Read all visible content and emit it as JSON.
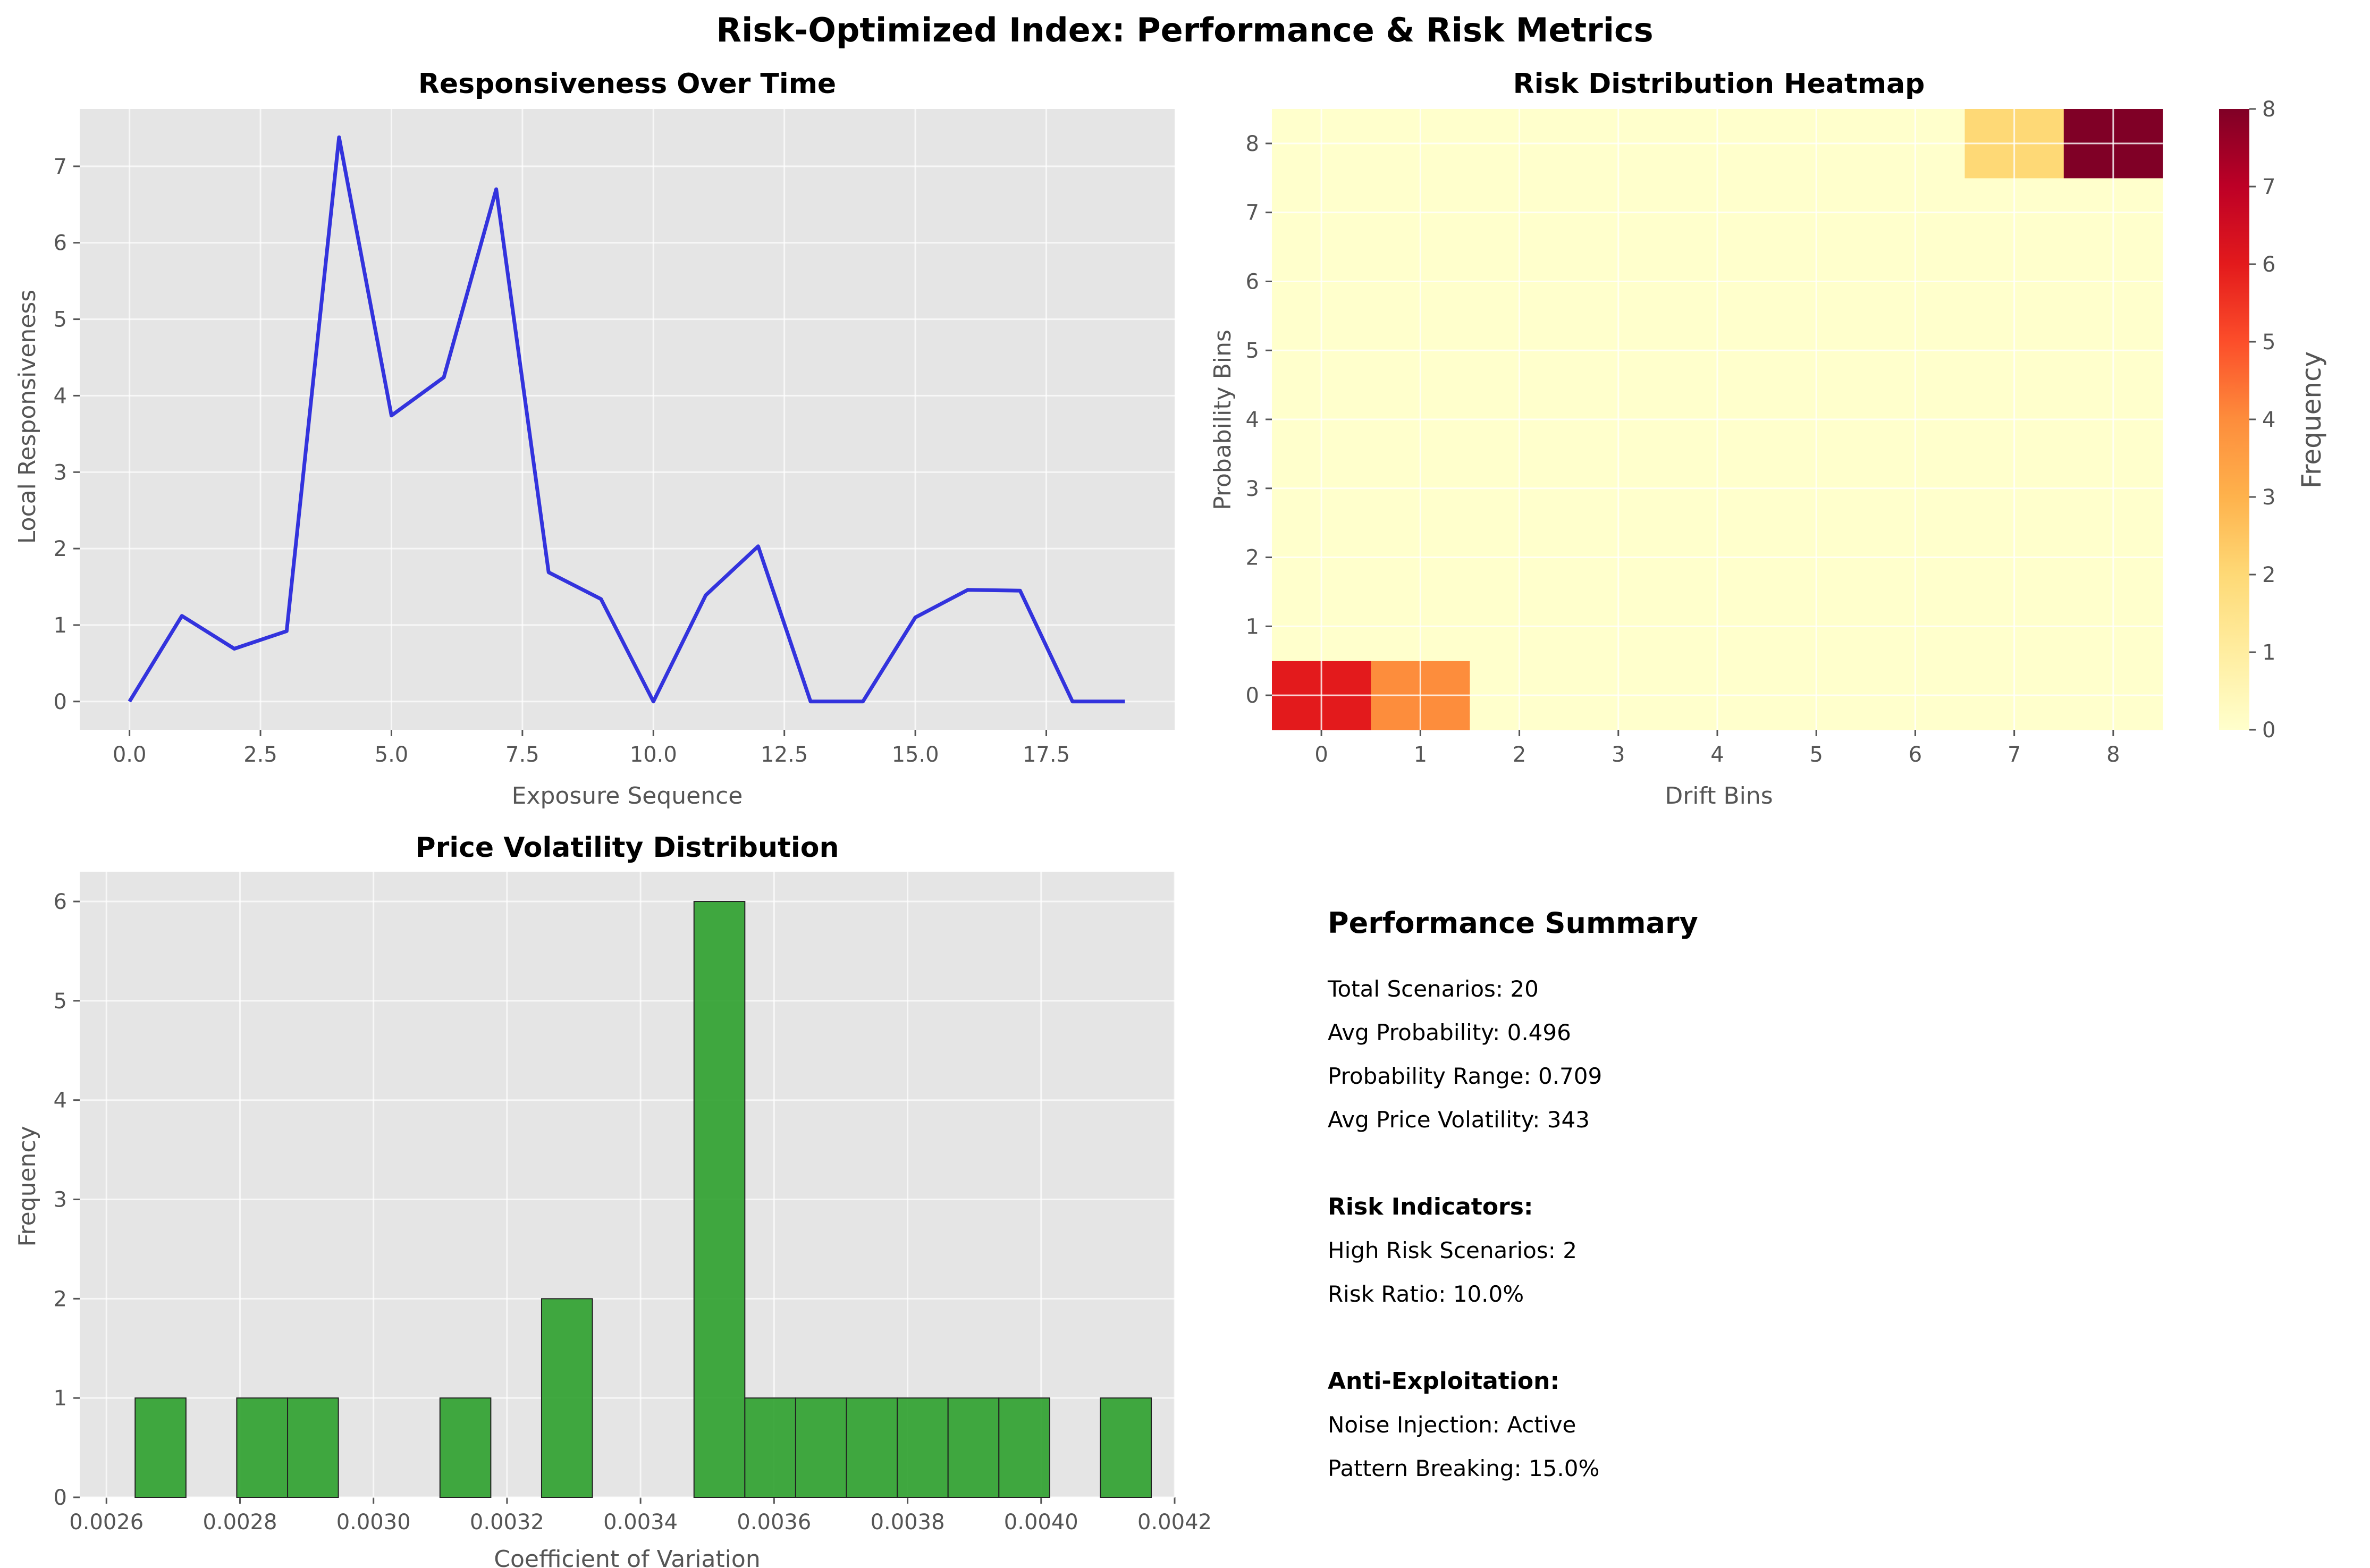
{
  "suptitle": "Risk-Optimized Index: Performance & Risk Metrics",
  "colors": {
    "axes_bg": "#e5e5e5",
    "grid": "#ffffff",
    "line": "#3333dd",
    "bar": "#2ca02c",
    "bar_edge": "#222222",
    "text": "#555555"
  },
  "chart_data": [
    {
      "id": "responsiveness",
      "type": "line",
      "title": "Responsiveness Over Time",
      "xlabel": "Exposure Sequence",
      "ylabel": "Local Responsiveness",
      "x": [
        0,
        1,
        2,
        3,
        4,
        5,
        6,
        7,
        8,
        9,
        10,
        11,
        12,
        13,
        14,
        15,
        16,
        17,
        18,
        19
      ],
      "y": [
        0,
        1.12,
        0.69,
        0.92,
        7.38,
        3.74,
        4.24,
        6.7,
        1.69,
        1.34,
        0,
        1.39,
        2.03,
        0,
        0,
        1.1,
        1.46,
        1.45,
        0,
        0
      ],
      "xlim": [
        -0.95,
        19.95
      ],
      "ylim": [
        -0.37,
        7.75
      ],
      "xticks": [
        0,
        2.5,
        5,
        7.5,
        10,
        12.5,
        15,
        17.5
      ],
      "xtick_labels": [
        "0.0",
        "2.5",
        "5.0",
        "7.5",
        "10.0",
        "12.5",
        "15.0",
        "17.5"
      ],
      "yticks": [
        0,
        1,
        2,
        3,
        4,
        5,
        6,
        7
      ],
      "ytick_labels": [
        "0",
        "1",
        "2",
        "3",
        "4",
        "5",
        "6",
        "7"
      ],
      "grid": true
    },
    {
      "id": "heatmap",
      "type": "heatmap",
      "title": "Risk Distribution Heatmap",
      "xlabel": "Drift Bins",
      "ylabel": "Probability Bins",
      "xticks": [
        "0",
        "1",
        "2",
        "3",
        "4",
        "5",
        "6",
        "7",
        "8"
      ],
      "yticks": [
        "0",
        "1",
        "2",
        "3",
        "4",
        "5",
        "6",
        "7",
        "8"
      ],
      "cells": [
        {
          "x": 0,
          "y": 0,
          "value": 6
        },
        {
          "x": 1,
          "y": 0,
          "value": 4
        },
        {
          "x": 7,
          "y": 8,
          "value": 2
        },
        {
          "x": 8,
          "y": 8,
          "value": 8
        }
      ],
      "default_value": 0,
      "vmin": 0,
      "vmax": 8,
      "colormap": "YlOrRd",
      "colorbar_label": "Frequency",
      "colorbar_ticks": [
        "0",
        "1",
        "2",
        "3",
        "4",
        "5",
        "6",
        "7",
        "8"
      ]
    },
    {
      "id": "volatility",
      "type": "bar",
      "title": "Price Volatility Distribution",
      "xlabel": "Coefficient of Variation",
      "ylabel": "Frequency",
      "bin_start": 0.002643,
      "bin_width": 7.61e-05,
      "counts": [
        1,
        0,
        1,
        1,
        0,
        0,
        1,
        0,
        2,
        0,
        0,
        6,
        1,
        1,
        1,
        1,
        1,
        1,
        0,
        1
      ],
      "xlim": [
        0.00256,
        0.0042
      ],
      "ylim": [
        0,
        6.3
      ],
      "xticks": [
        0.0026,
        0.0028,
        0.003,
        0.0032,
        0.0034,
        0.0036,
        0.0038,
        0.004,
        0.0042
      ],
      "xtick_labels": [
        "0.0026",
        "0.0028",
        "0.0030",
        "0.0032",
        "0.0034",
        "0.0036",
        "0.0038",
        "0.0040",
        "0.0042"
      ],
      "yticks": [
        0,
        1,
        2,
        3,
        4,
        5,
        6
      ],
      "ytick_labels": [
        "0",
        "1",
        "2",
        "3",
        "4",
        "5",
        "6"
      ],
      "grid": true
    }
  ],
  "summary": {
    "title": "Performance Summary",
    "lines": [
      "Total Scenarios: 20",
      "Avg Probability: 0.496",
      "Probability Range: 0.709",
      "Avg Price Volatility: 343"
    ],
    "risk_heading": "Risk Indicators:",
    "risk_lines": [
      "High Risk Scenarios: 2",
      "Risk Ratio: 10.0%"
    ],
    "anti_heading": "Anti-Exploitation:",
    "anti_lines": [
      "Noise Injection: Active",
      "Pattern Breaking: 15.0%"
    ]
  }
}
